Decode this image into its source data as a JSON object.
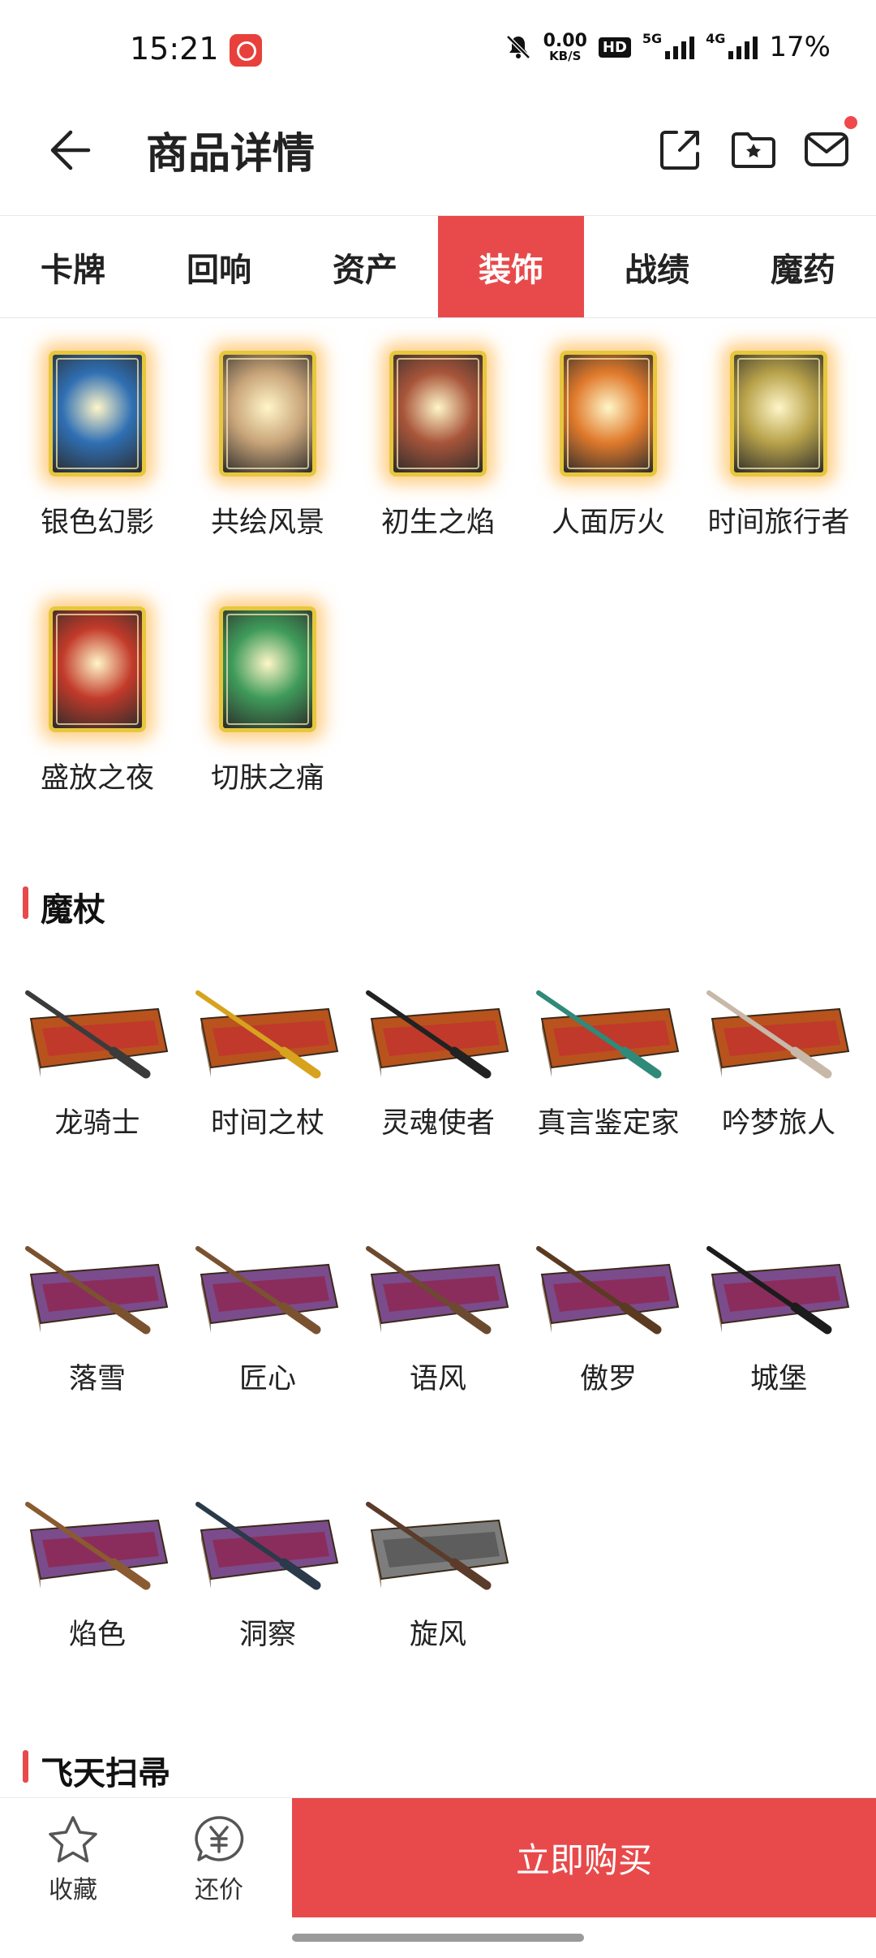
{
  "status": {
    "time": "15:21",
    "netspeed_value": "0.00",
    "netspeed_unit": "KB/S",
    "hd": "HD",
    "net1": "5G",
    "net2": "4G",
    "battery": "17%"
  },
  "header": {
    "title": "商品详情",
    "icons": [
      "back-arrow-icon",
      "share-icon",
      "favorite-folder-icon",
      "mail-icon"
    ]
  },
  "tabs": [
    "卡牌",
    "回响",
    "资产",
    "装饰",
    "战绩",
    "魔药"
  ],
  "active_tab": "装饰",
  "cards": [
    {
      "label": "银色幻影",
      "color": "#2f6fb3"
    },
    {
      "label": "共绘风景",
      "color": "#c9a57a"
    },
    {
      "label": "初生之焰",
      "color": "#a8553a"
    },
    {
      "label": "人面厉火",
      "color": "#e07a2c"
    },
    {
      "label": "时间旅行者",
      "color": "#b8a24a"
    },
    {
      "label": "盛放之夜",
      "color": "#c23a2a"
    },
    {
      "label": "切肤之痛",
      "color": "#3f9b5a"
    }
  ],
  "wand_section": "魔杖",
  "wands": [
    {
      "label": "龙骑士",
      "box": "#b8531d",
      "inner": "#c0392b",
      "wand": "#3b3b3b"
    },
    {
      "label": "时间之杖",
      "box": "#b8531d",
      "inner": "#c0392b",
      "wand": "#d7a21e"
    },
    {
      "label": "灵魂使者",
      "box": "#b8531d",
      "inner": "#c0392b",
      "wand": "#222222"
    },
    {
      "label": "真言鉴定家",
      "box": "#b8531d",
      "inner": "#c0392b",
      "wand": "#2f8a7a"
    },
    {
      "label": "吟梦旅人",
      "box": "#b8531d",
      "inner": "#c0392b",
      "wand": "#c8b8a8"
    },
    {
      "label": "落雪",
      "box": "#7b4c8c",
      "inner": "#8b2d5c",
      "wand": "#7a5230"
    },
    {
      "label": "匠心",
      "box": "#7b4c8c",
      "inner": "#8b2d5c",
      "wand": "#7a5230"
    },
    {
      "label": "语风",
      "box": "#7b4c8c",
      "inner": "#8b2d5c",
      "wand": "#6b4a2f"
    },
    {
      "label": "傲罗",
      "box": "#7b4c8c",
      "inner": "#8b2d5c",
      "wand": "#5a3b22"
    },
    {
      "label": "城堡",
      "box": "#7b4c8c",
      "inner": "#8b2d5c",
      "wand": "#1c1c1c"
    },
    {
      "label": "焰色",
      "box": "#7b4c8c",
      "inner": "#8b2d5c",
      "wand": "#8a5a30"
    },
    {
      "label": "洞察",
      "box": "#7b4c8c",
      "inner": "#8b2d5c",
      "wand": "#2a3a4a"
    },
    {
      "label": "旋风",
      "box": "#7d7d7d",
      "inner": "#5d5d5d",
      "wand": "#5b3b2a"
    }
  ],
  "broom_section": "飞天扫帚",
  "bottom": {
    "collect": "收藏",
    "bargain": "还价",
    "buy": "立即购买"
  },
  "accent": "#e84a4b"
}
